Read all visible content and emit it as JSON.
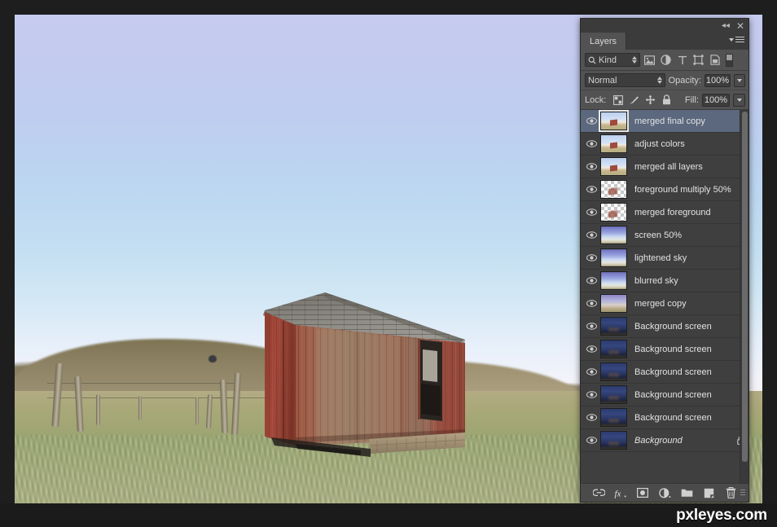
{
  "photo": {
    "description": "Weathered red wooden barn shed in a grassy field with fence posts, rocky hill ridge, and a pale lavender-blue sky",
    "sky_top_color": "#c6cbef",
    "sky_horizon_color": "#f5f1f6",
    "barn_wall_color": "#9e4a3c",
    "roof_color": "#8b8a85",
    "grass_color": "#a3ab7b"
  },
  "watermark": {
    "text": "pxleyes.com"
  },
  "panel": {
    "title_tab": "Layers",
    "titlebar": {
      "collapse_icon": "double-chevron-left-icon",
      "close_icon": "close-icon"
    },
    "menu_icon": "panel-menu-icon",
    "filter": {
      "search_icon": "search-icon",
      "kind_label": "Kind",
      "buttons": [
        {
          "icon": "filter-pixel-layers-icon",
          "name": "filter-pixel-layers"
        },
        {
          "icon": "filter-adjustment-layers-icon",
          "name": "filter-adjustment-layers"
        },
        {
          "icon": "filter-type-layers-icon",
          "name": "filter-type-layers"
        },
        {
          "icon": "filter-shape-layers-icon",
          "name": "filter-shape-layers"
        },
        {
          "icon": "filter-smart-object-icon",
          "name": "filter-smart-objects"
        }
      ],
      "toggle_name": "filter-enable-toggle"
    },
    "blend": {
      "mode": "Normal",
      "opacity_label": "Opacity:",
      "opacity_value": "100%"
    },
    "lock": {
      "label": "Lock:",
      "icons": [
        {
          "icon": "lock-transparent-pixels-icon",
          "name": "lock-transparent-pixels"
        },
        {
          "icon": "lock-image-pixels-icon",
          "name": "lock-image-pixels"
        },
        {
          "icon": "lock-position-icon",
          "name": "lock-position"
        },
        {
          "icon": "lock-all-icon",
          "name": "lock-all"
        }
      ],
      "fill_label": "Fill:",
      "fill_value": "100%"
    },
    "layers": [
      {
        "name": "merged final copy",
        "thumb": "th-day",
        "selected": true,
        "locked": false,
        "italic": false
      },
      {
        "name": "adjust colors",
        "thumb": "th-day",
        "selected": false,
        "locked": false,
        "italic": false
      },
      {
        "name": "merged all layers",
        "thumb": "th-day",
        "selected": false,
        "locked": false,
        "italic": false
      },
      {
        "name": "foreground multiply 50%",
        "thumb": "th-alpha",
        "selected": false,
        "locked": false,
        "italic": false
      },
      {
        "name": "merged foreground",
        "thumb": "th-alpha",
        "selected": false,
        "locked": false,
        "italic": false
      },
      {
        "name": "screen 50%",
        "thumb": "th-blursky",
        "selected": false,
        "locked": false,
        "italic": false
      },
      {
        "name": "lightened sky",
        "thumb": "th-blursky",
        "selected": false,
        "locked": false,
        "italic": false
      },
      {
        "name": "blurred sky",
        "thumb": "th-blursky",
        "selected": false,
        "locked": false,
        "italic": false
      },
      {
        "name": "merged copy",
        "thumb": "th-mergedcopy",
        "selected": false,
        "locked": false,
        "italic": false
      },
      {
        "name": "Background screen",
        "thumb": "th-night",
        "selected": false,
        "locked": false,
        "italic": false
      },
      {
        "name": "Background screen",
        "thumb": "th-night",
        "selected": false,
        "locked": false,
        "italic": false
      },
      {
        "name": "Background screen",
        "thumb": "th-night",
        "selected": false,
        "locked": false,
        "italic": false
      },
      {
        "name": "Background screen",
        "thumb": "th-night",
        "selected": false,
        "locked": false,
        "italic": false
      },
      {
        "name": "Background screen",
        "thumb": "th-night",
        "selected": false,
        "locked": false,
        "italic": false
      },
      {
        "name": "Background",
        "thumb": "th-night",
        "selected": false,
        "locked": true,
        "italic": true
      }
    ],
    "bottom_toolbar": [
      {
        "icon": "link-layers-icon",
        "name": "link-layers-button",
        "glyph": "link"
      },
      {
        "icon": "layer-style-fx-icon",
        "name": "add-layer-style-button",
        "glyph": "fx"
      },
      {
        "icon": "add-layer-mask-icon",
        "name": "add-layer-mask-button",
        "glyph": "mask"
      },
      {
        "icon": "adjustment-layer-icon",
        "name": "new-adjustment-layer-button",
        "glyph": "adj"
      },
      {
        "icon": "new-group-icon",
        "name": "new-group-button",
        "glyph": "folder"
      },
      {
        "icon": "new-layer-icon",
        "name": "new-layer-button",
        "glyph": "newlayer"
      },
      {
        "icon": "delete-layer-icon",
        "name": "delete-layer-button",
        "glyph": "trash"
      }
    ]
  }
}
